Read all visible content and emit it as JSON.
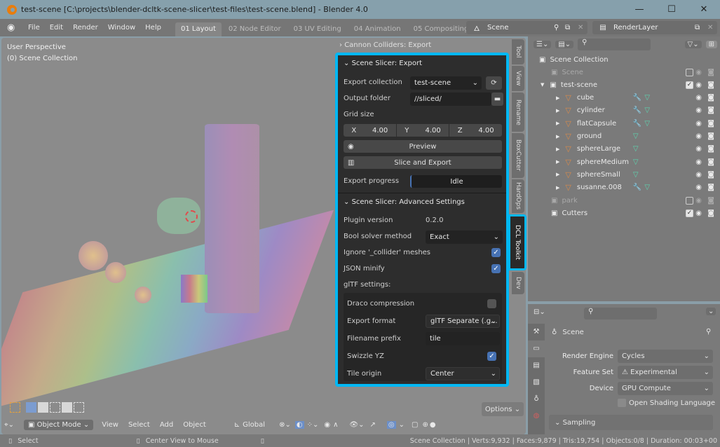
{
  "window": {
    "title": "test-scene [C:\\projects\\blender-dcltk-scene-slicer\\test-files\\test-scene.blend] - Blender 4.0",
    "minimize": "—",
    "maximize": "☐",
    "close": "✕"
  },
  "menu": {
    "items": [
      "File",
      "Edit",
      "Render",
      "Window",
      "Help"
    ],
    "workspaces": [
      "01 Layout",
      "02 Node Editor",
      "03 UV Editing",
      "04 Animation",
      "05 Compositing"
    ],
    "active_workspace": "01 Layout",
    "scene_name": "Scene",
    "view_layer": "RenderLayer"
  },
  "viewport": {
    "view_name": "User Perspective",
    "collection_info": "(0) Scene Collection",
    "options_label": "Options",
    "mode": "Object Mode",
    "menu": [
      "View",
      "Select",
      "Add",
      "Object"
    ],
    "orientation": "Global"
  },
  "sidebar_tabs": [
    "Tool",
    "View",
    "Rename",
    "BoxCutter",
    "HardOps",
    "DCL Toolkit",
    "Dev"
  ],
  "active_sidebar_tab": "DCL Toolkit",
  "panels": {
    "collapsed": "Cannon Colliders: Export",
    "export": {
      "title": "Scene Slicer: Export",
      "export_collection_label": "Export collection",
      "export_collection_value": "test-scene",
      "output_folder_label": "Output folder",
      "output_folder_value": "//sliced/",
      "grid_size_label": "Grid size",
      "grid": [
        {
          "axis": "X",
          "value": "4.00"
        },
        {
          "axis": "Y",
          "value": "4.00"
        },
        {
          "axis": "Z",
          "value": "4.00"
        }
      ],
      "preview_label": "Preview",
      "slice_export_label": "Slice and Export",
      "progress_label": "Export progress",
      "progress_value": "Idle",
      "progress_fraction": 0
    },
    "advanced": {
      "title": "Scene Slicer: Advanced Settings",
      "plugin_version_label": "Plugin version",
      "plugin_version_value": "0.2.0",
      "bool_solver_label": "Bool solver method",
      "bool_solver_value": "Exact",
      "ignore_collider_label": "Ignore '_collider' meshes",
      "ignore_collider_checked": true,
      "json_minify_label": "JSON minify",
      "json_minify_checked": true,
      "gltf_label": "glTF settings:",
      "draco_label": "Draco compression",
      "draco_checked": false,
      "export_format_label": "Export format",
      "export_format_value": "glTF Separate (.g...",
      "filename_prefix_label": "Filename prefix",
      "filename_prefix_value": "tile",
      "swizzle_label": "Swizzle YZ",
      "swizzle_checked": true,
      "tile_origin_label": "Tile origin",
      "tile_origin_value": "Center"
    }
  },
  "outliner": {
    "root": "Scene Collection",
    "rows": [
      {
        "name": "Scene",
        "type": "collection",
        "dim": true,
        "checked": false
      },
      {
        "name": "test-scene",
        "type": "collection",
        "dim": false,
        "checked": true
      },
      {
        "name": "cube",
        "type": "mesh",
        "modifier": true
      },
      {
        "name": "cylinder",
        "type": "mesh",
        "modifier": true
      },
      {
        "name": "flatCapsule",
        "type": "mesh",
        "modifier": true
      },
      {
        "name": "ground",
        "type": "mesh",
        "modifier": false
      },
      {
        "name": "sphereLarge",
        "type": "mesh",
        "modifier": false
      },
      {
        "name": "sphereMedium",
        "type": "mesh",
        "modifier": false
      },
      {
        "name": "sphereSmall",
        "type": "mesh",
        "modifier": false
      },
      {
        "name": "susanne.008",
        "type": "mesh",
        "modifier": true
      },
      {
        "name": "park",
        "type": "collection",
        "dim": true,
        "checked": false
      },
      {
        "name": "Cutters",
        "type": "collection",
        "dim": false,
        "checked": true
      }
    ]
  },
  "properties": {
    "context": "Scene",
    "render_engine_label": "Render Engine",
    "render_engine_value": "Cycles",
    "feature_set_label": "Feature Set",
    "feature_set_value": "Experimental",
    "device_label": "Device",
    "device_value": "GPU Compute",
    "osl_label": "Open Shading Language",
    "sampling_label": "Sampling"
  },
  "status": {
    "select": "Select",
    "center_view": "Center View to Mouse",
    "stats": "Scene Collection | Verts:9,932 | Faces:9,879 | Tris:19,754 | Objects:0/8 | Duration: 00:03+00"
  }
}
